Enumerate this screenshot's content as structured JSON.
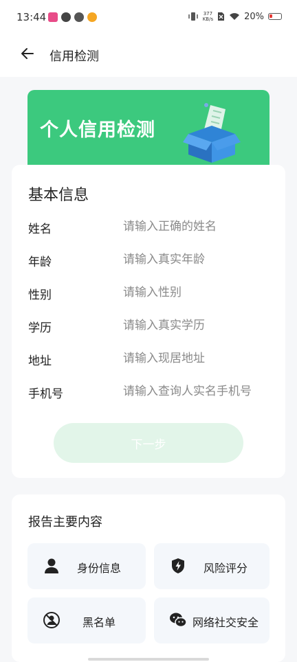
{
  "status_bar": {
    "time": "13:44",
    "net_speed_value": "377",
    "net_speed_unit": "KB/s",
    "battery": "20%"
  },
  "header": {
    "title": "信用检测"
  },
  "banner": {
    "title": "个人信用检测"
  },
  "basic_info": {
    "title": "基本信息",
    "fields": [
      {
        "label": "姓名",
        "placeholder": "请输入正确的姓名"
      },
      {
        "label": "年龄",
        "placeholder": "请输入真实年龄"
      },
      {
        "label": "性别",
        "placeholder": "请输入性别"
      },
      {
        "label": "学历",
        "placeholder": "请输入真实学历"
      },
      {
        "label": "地址",
        "placeholder": "请输入现居地址"
      },
      {
        "label": "手机号",
        "placeholder": "请输入查询人实名手机号"
      }
    ],
    "next_button": "下一步"
  },
  "report": {
    "title": "报告主要内容",
    "items": [
      {
        "label": "身份信息",
        "icon": "person-icon"
      },
      {
        "label": "风险评分",
        "icon": "shield-lightning-icon"
      },
      {
        "label": "黑名单",
        "icon": "blocked-user-icon"
      },
      {
        "label": "网络社交安全",
        "icon": "wechat-icon"
      }
    ]
  },
  "colors": {
    "brand_green": "#3cc97e",
    "button_disabled": "#e2f5e9"
  }
}
